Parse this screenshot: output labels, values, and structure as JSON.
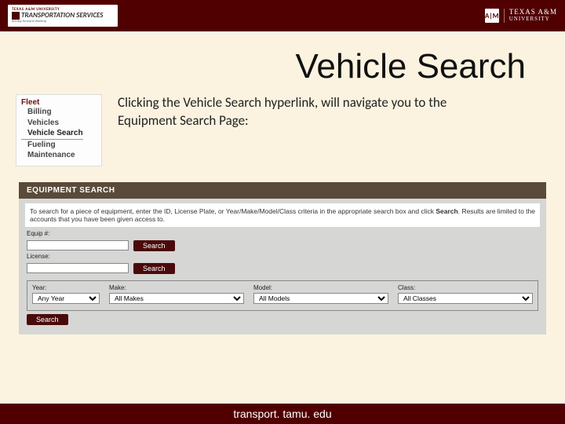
{
  "header": {
    "badge": {
      "line1": "TEXAS A&M UNIVERSITY",
      "line2": "TRANSPORTATION SERVICES",
      "line3": "driving forward thinking"
    },
    "tamu": {
      "mark": "A|M",
      "name1": "TEXAS A&M",
      "name2": "UNIVERSITY"
    }
  },
  "title": "Vehicle Search",
  "nav": {
    "head": "Fleet",
    "items": [
      "Billing",
      "Vehicles",
      "Vehicle Search",
      "Fueling",
      "Maintenance"
    ],
    "selected_index": 2
  },
  "instruction": "Clicking the Vehicle Search hyperlink, will navigate you to the Equipment Search Page:",
  "search_panel": {
    "heading": "EQUIPMENT SEARCH",
    "hint_prefix": "To search for a piece of equipment, enter the ID, License Plate, or Year/Make/Model/Class criteria in the appropriate search box and click ",
    "hint_bold": "Search",
    "hint_suffix": ". Results are limited to the accounts that you have been given access to.",
    "equip_label": "Equip #:",
    "equip_value": "",
    "license_label": "License:",
    "license_value": "",
    "search_button": "Search",
    "criteria": {
      "year_label": "Year:",
      "year_value": "Any Year",
      "make_label": "Make:",
      "make_value": "All Makes",
      "model_label": "Model:",
      "model_value": "All Models",
      "class_label": "Class:",
      "class_value": "All Classes"
    }
  },
  "footer": "transport. tamu. edu"
}
